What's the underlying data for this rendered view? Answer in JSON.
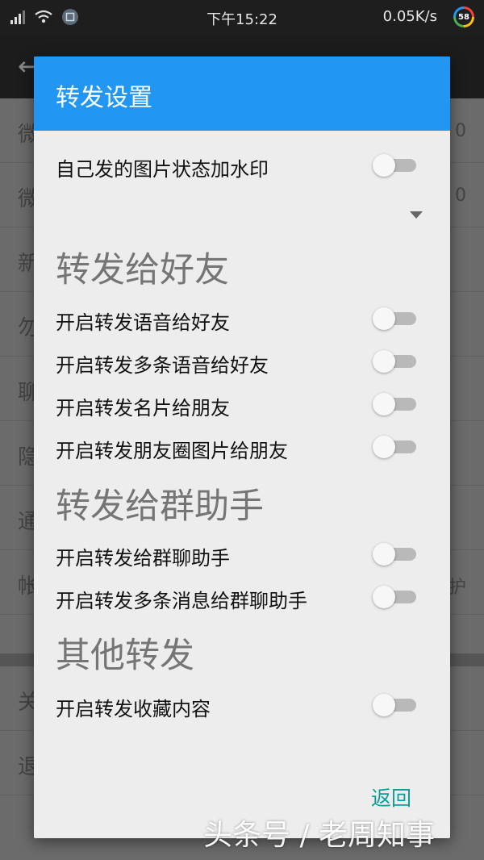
{
  "status_bar": {
    "time": "下午15:22",
    "speed": "0.05K/s",
    "badge": "58"
  },
  "background_list": {
    "rows": [
      {
        "left": "微",
        "right": "0"
      },
      {
        "left": "微",
        "right": "0"
      },
      {
        "left": "新",
        "right": ""
      },
      {
        "left": "勿",
        "right": ""
      },
      {
        "left": "聊",
        "right": ""
      },
      {
        "left": "隐",
        "right": ""
      },
      {
        "left": "通",
        "right": ""
      },
      {
        "left": "帐",
        "right": "护"
      },
      {
        "left": "关",
        "right": ""
      },
      {
        "left": "退",
        "right": ""
      }
    ]
  },
  "dialog": {
    "title": "转发设置",
    "watermark_toggle": {
      "label": "自己发的图片状态加水印",
      "on": false
    },
    "sections": [
      {
        "title": "转发给好友",
        "items": [
          {
            "label": "开启转发语音给好友",
            "on": false
          },
          {
            "label": "开启转发多条语音给好友",
            "on": false
          },
          {
            "label": "开启转发名片给朋友",
            "on": false
          },
          {
            "label": "开启转发朋友圈图片给朋友",
            "on": false
          }
        ]
      },
      {
        "title": "转发给群助手",
        "items": [
          {
            "label": "开启转发给群聊助手",
            "on": false
          },
          {
            "label": "开启转发多条消息给群聊助手",
            "on": false
          }
        ]
      },
      {
        "title": "其他转发",
        "items": [
          {
            "label": "开启转发收藏内容",
            "on": false
          }
        ]
      }
    ],
    "back_label": "返回"
  },
  "watermark": "头条号 / 老周知事",
  "colors": {
    "header": "#2196f3",
    "dialog_bg": "#ededed",
    "back_button": "#0f9d9a",
    "switch_track_off": "#b9b9b9"
  }
}
